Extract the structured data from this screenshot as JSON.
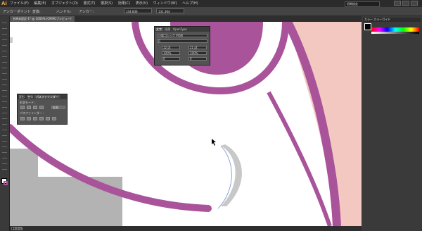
{
  "app": {
    "logo": "Ai",
    "workspace": "初期設定"
  },
  "menu": [
    "ファイル(F)",
    "編集(E)",
    "オブジェクト(O)",
    "書式(T)",
    "選択(S)",
    "効果(C)",
    "表示(V)",
    "ウィンドウ(W)",
    "ヘルプ(H)"
  ],
  "options": {
    "label": "アンカーポイント",
    "convert": "変換:",
    "handle": "ハンドル:",
    "anchor": "アンカー:",
    "x": "144.836",
    "y": "131.364"
  },
  "document_tab": "名称未設定-1* @ 1000% (CMYK/プレビュー)",
  "status": {
    "zoom": "1000%"
  },
  "char_panel": {
    "tabs": [
      "文字",
      "段落",
      "OpenType"
    ],
    "font": "小塚ゴシック Pr6N",
    "style": "R",
    "size": "12 pt",
    "leading": "21 pt",
    "scale": "100%",
    "kerning": "0"
  },
  "pathfinder_panel": {
    "tabs": [
      "変形",
      "整列",
      "パスファインダー"
    ],
    "shape_modes_label": "形状モード :",
    "pathfinders_label": "パスファインダー :",
    "expand_label": "拡張"
  },
  "right_panel": {
    "header": "カラー  カラーガイド"
  },
  "colors": {
    "magenta": "#a9539a",
    "pink": "#f2c8c0",
    "grey": "#b3b3b3"
  }
}
